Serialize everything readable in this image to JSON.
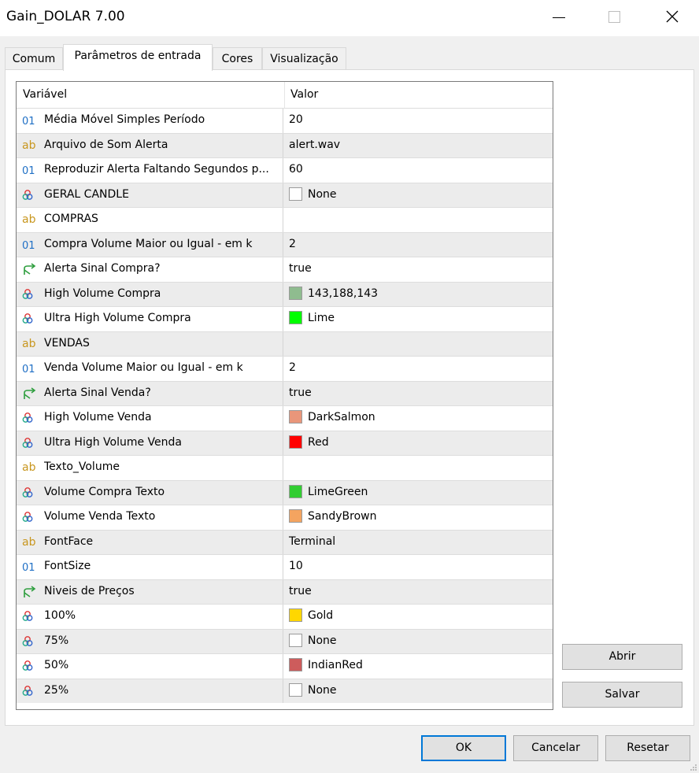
{
  "window": {
    "title": "Gain_DOLAR 7.00"
  },
  "tabs": [
    {
      "label": "Comum",
      "active": false
    },
    {
      "label": "Parâmetros de entrada",
      "active": true
    },
    {
      "label": "Cores",
      "active": false
    },
    {
      "label": "Visualização",
      "active": false
    }
  ],
  "grid": {
    "columns": {
      "variable": "Variável",
      "value": "Valor"
    },
    "rows": [
      {
        "type": "int",
        "icon": "int-icon",
        "name": "Média Móvel Simples Período",
        "value": "20"
      },
      {
        "type": "string",
        "icon": "string-icon",
        "name": "Arquivo de Som Alerta",
        "value": "alert.wav"
      },
      {
        "type": "int",
        "icon": "int-icon",
        "name": "Reproduzir Alerta Faltando Segundos p...",
        "value": "60"
      },
      {
        "type": "color",
        "icon": "color-icon",
        "name": "GERAL CANDLE",
        "value": "None",
        "color": "#ffffff"
      },
      {
        "type": "string",
        "icon": "string-icon",
        "name": "COMPRAS",
        "value": ""
      },
      {
        "type": "int",
        "icon": "int-icon",
        "name": "Compra Volume Maior ou Igual - em k",
        "value": "2"
      },
      {
        "type": "bool",
        "icon": "bool-icon",
        "name": "Alerta Sinal Compra?",
        "value": "true"
      },
      {
        "type": "color",
        "icon": "color-icon",
        "name": "High Volume Compra",
        "value": "143,188,143",
        "color": "#8fbc8f"
      },
      {
        "type": "color",
        "icon": "color-icon",
        "name": "Ultra High Volume Compra",
        "value": "Lime",
        "color": "#00ff00"
      },
      {
        "type": "string",
        "icon": "string-icon",
        "name": "VENDAS",
        "value": ""
      },
      {
        "type": "int",
        "icon": "int-icon",
        "name": "Venda Volume Maior ou Igual - em k",
        "value": "2"
      },
      {
        "type": "bool",
        "icon": "bool-icon",
        "name": "Alerta Sinal Venda?",
        "value": "true"
      },
      {
        "type": "color",
        "icon": "color-icon",
        "name": "High Volume Venda",
        "value": "DarkSalmon",
        "color": "#e9967a"
      },
      {
        "type": "color",
        "icon": "color-icon",
        "name": "Ultra High Volume Venda",
        "value": "Red",
        "color": "#ff0000"
      },
      {
        "type": "string",
        "icon": "string-icon",
        "name": "Texto_Volume",
        "value": ""
      },
      {
        "type": "color",
        "icon": "color-icon",
        "name": "Volume Compra Texto",
        "value": "LimeGreen",
        "color": "#32cd32"
      },
      {
        "type": "color",
        "icon": "color-icon",
        "name": "Volume Venda Texto",
        "value": "SandyBrown",
        "color": "#f4a460"
      },
      {
        "type": "string",
        "icon": "string-icon",
        "name": "FontFace",
        "value": "Terminal"
      },
      {
        "type": "int",
        "icon": "int-icon",
        "name": "FontSize",
        "value": "10"
      },
      {
        "type": "bool",
        "icon": "bool-icon",
        "name": "Niveis de Preços",
        "value": "true"
      },
      {
        "type": "color",
        "icon": "color-icon",
        "name": "100%",
        "value": "Gold",
        "color": "#ffd700"
      },
      {
        "type": "color",
        "icon": "color-icon",
        "name": "75%",
        "value": "None",
        "color": "#ffffff"
      },
      {
        "type": "color",
        "icon": "color-icon",
        "name": "50%",
        "value": "IndianRed",
        "color": "#cd5c5c"
      },
      {
        "type": "color",
        "icon": "color-icon",
        "name": "25%",
        "value": "None",
        "color": "#ffffff"
      }
    ]
  },
  "side_buttons": {
    "open": "Abrir",
    "save": "Salvar"
  },
  "footer": {
    "ok": "OK",
    "cancel": "Cancelar",
    "reset": "Resetar"
  },
  "colors": {
    "accent": "#0078d7",
    "int_icon": "#1f6fc5",
    "string_icon": "#c8961e",
    "bool_icon": "#2e9e3e"
  }
}
